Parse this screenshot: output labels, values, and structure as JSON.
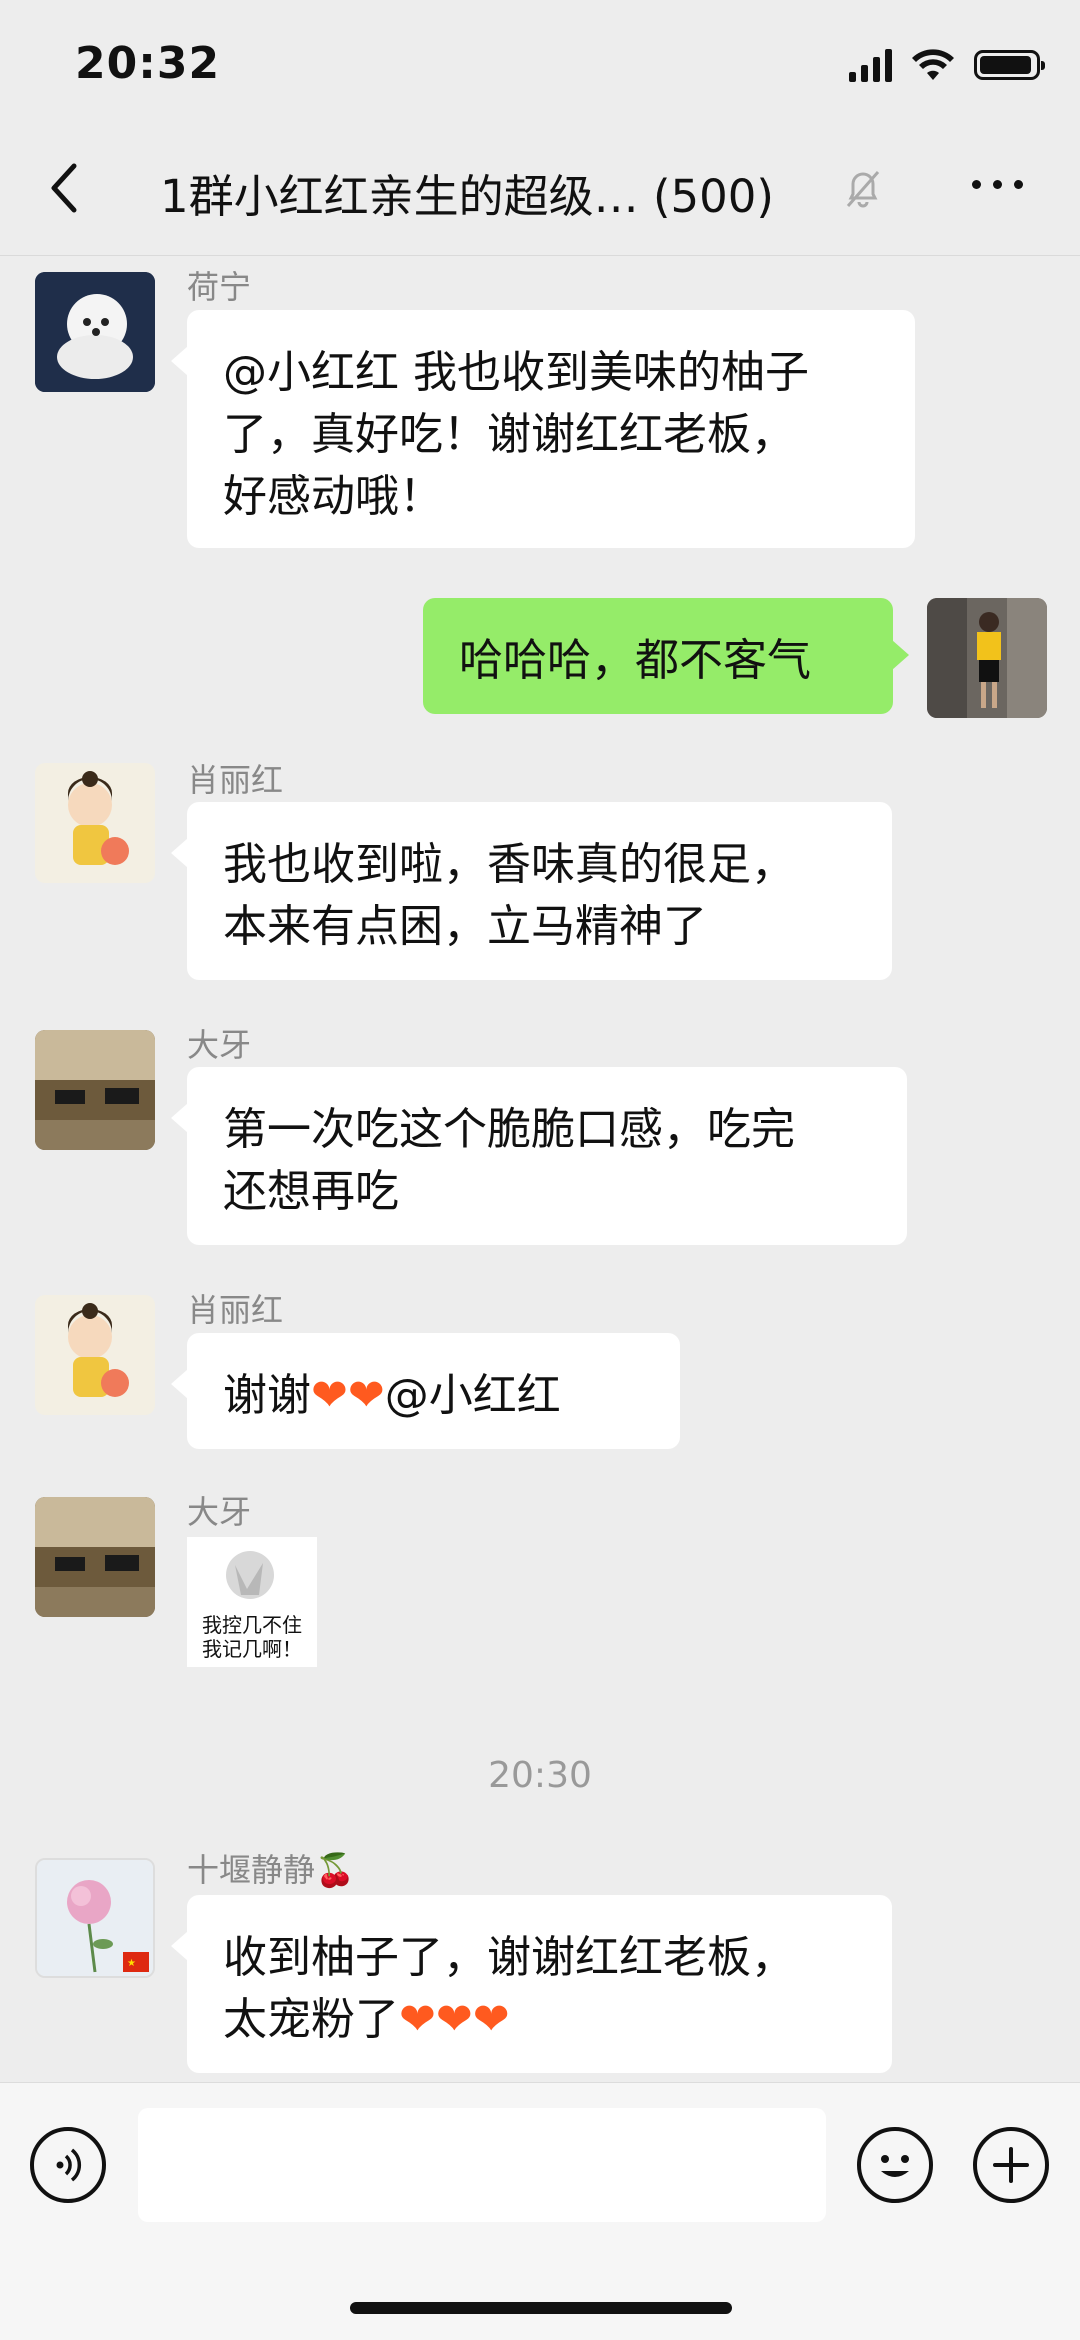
{
  "status": {
    "time": "20:32"
  },
  "nav": {
    "title": "1群小红红亲生的超级…",
    "count": "(500)"
  },
  "messages": [
    {
      "sender": "荷宁",
      "text_lines": [
        "@小红红 我也收到美味的柚子",
        "了，真好吃！谢谢红红老板，",
        "好感动哦！"
      ]
    },
    {
      "text": "哈哈哈，都不客气"
    },
    {
      "sender": "肖丽红",
      "text_lines": [
        "我也收到啦，香味真的很足，",
        "本来有点困，立马精神了"
      ]
    },
    {
      "sender": "大牙",
      "text_lines": [
        "第一次吃这个脆脆口感，吃完",
        "还想再吃"
      ]
    },
    {
      "sender": "肖丽红",
      "text_pre": "谢谢",
      "text_post": "@小红红",
      "hearts": "❤❤"
    },
    {
      "sender": "大牙",
      "sticker_lines": [
        "我控几不住",
        "我记几啊！"
      ]
    },
    {
      "sender": "十堰静静",
      "sender_emoji": "🍒",
      "text_line1": "收到柚子了，谢谢红红老板，",
      "text_line2_pre": "太宠粉了",
      "hearts": "❤❤❤"
    }
  ],
  "timestamp": "20:30",
  "input": {
    "value": ""
  }
}
